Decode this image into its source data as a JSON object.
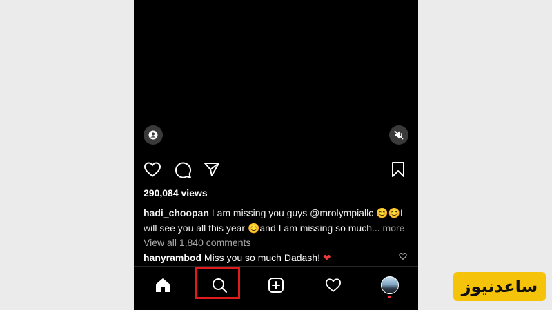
{
  "post": {
    "views": "290,084 views",
    "caption_user": "hadi_choopan",
    "caption_text": " I  am missing you  guys @mrolympiallc 😊😊I will see you all  this year 😊and I am missing so much...",
    "caption_more": " more",
    "view_all_comments": "View all 1,840 comments",
    "comment_user": "hanyrambod",
    "comment_text": " Miss you so much Dadash! ",
    "comment_heart": "❤"
  },
  "icons": {
    "tag": "person-tag-icon",
    "mute": "speaker-muted-icon",
    "like": "heart-icon",
    "comment": "comment-bubble-icon",
    "share": "paper-plane-icon",
    "save": "bookmark-icon",
    "home": "home-icon",
    "search": "search-icon",
    "create": "plus-square-icon",
    "activity": "heart-icon",
    "profile": "profile-avatar"
  },
  "watermark": {
    "text": "ساعدنیوز"
  },
  "colors": {
    "highlight": "#e01b1b",
    "watermark_bg": "#f5c40a",
    "heart": "#e83a3a"
  }
}
